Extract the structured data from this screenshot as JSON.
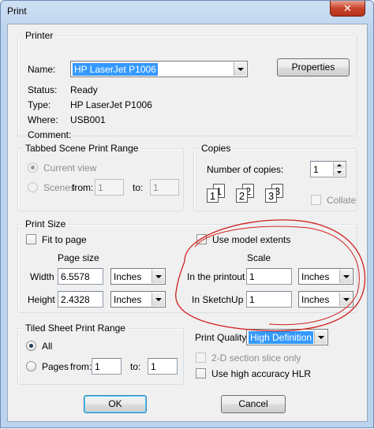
{
  "window": {
    "title": "Print",
    "close": "✕"
  },
  "printer": {
    "legend": "Printer",
    "name_label": "Name:",
    "name_value": "HP LaserJet P1006",
    "properties_button": "Properties",
    "status_label": "Status:",
    "status_value": "Ready",
    "type_label": "Type:",
    "type_value": "HP LaserJet P1006",
    "where_label": "Where:",
    "where_value": "USB001",
    "comment_label": "Comment:"
  },
  "scene_range": {
    "legend": "Tabbed Scene Print Range",
    "current_view": "Current view",
    "scenes": "Scenes",
    "from_label": "from:",
    "from_value": "1",
    "to_label": "to:",
    "to_value": "1"
  },
  "copies": {
    "legend": "Copies",
    "number_label": "Number of copies:",
    "number_value": "1",
    "collate": "Collate",
    "page_numbers": [
      "1",
      "1",
      "2",
      "2",
      "3",
      "3"
    ]
  },
  "print_size": {
    "legend": "Print Size",
    "fit_to_page": "Fit to page",
    "use_model_extents": "Use model extents",
    "page_size": "Page size",
    "scale": "Scale",
    "width_label": "Width",
    "width_value": "6.5578",
    "width_unit": "Inches",
    "height_label": "Height",
    "height_value": "2.4328",
    "height_unit": "Inches",
    "printout_label": "In the printout",
    "printout_value": "1",
    "printout_unit": "Inches",
    "sketchup_label": "In SketchUp",
    "sketchup_value": "1",
    "sketchup_unit": "Inches"
  },
  "tiled": {
    "legend": "Tiled Sheet Print Range",
    "all": "All",
    "pages": "Pages",
    "from_label": "from:",
    "from_value": "1",
    "to_label": "to:",
    "to_value": "1"
  },
  "quality": {
    "label": "Print Quality",
    "value": "High Definition",
    "section_slice": "2-D section slice only",
    "hlr": "Use high accuracy HLR"
  },
  "buttons": {
    "ok": "OK",
    "cancel": "Cancel"
  },
  "annotation": {
    "stroke_color": "#d0201e"
  }
}
